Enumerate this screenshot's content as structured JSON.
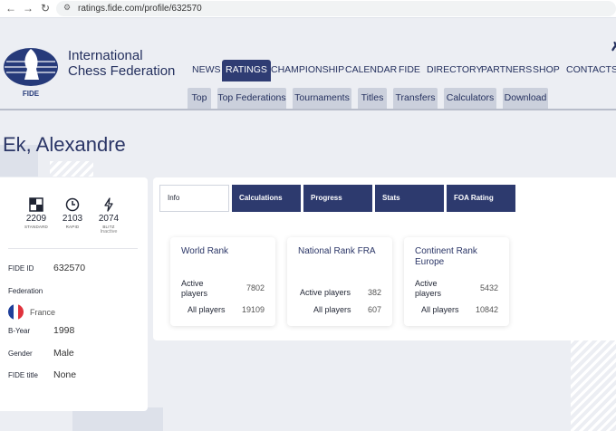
{
  "browser": {
    "back_icon": "arrow-left-icon",
    "forward_icon": "arrow-right-icon",
    "reload_icon": "reload-icon",
    "url": "ratings.fide.com/profile/632570"
  },
  "header": {
    "logo_text": "FIDE",
    "org_line1": "International",
    "org_line2": "Chess Federation",
    "main_nav": [
      "NEWS",
      "RATINGS",
      "CHAMPIONSHIP",
      "CALENDAR",
      "FIDE",
      "DIRECTORY",
      "PARTNERS",
      "SHOP",
      "CONTACTS"
    ],
    "active_nav": "RATINGS",
    "sub_nav": [
      "Top",
      "Top Federations",
      "Tournaments",
      "Titles",
      "Transfers",
      "Calculators",
      "Download"
    ]
  },
  "player": {
    "name": "Ek, Alexandre",
    "ratings": [
      {
        "value": "2209",
        "label": "STANDARD",
        "note": "",
        "icon": "standard-board-icon"
      },
      {
        "value": "2103",
        "label": "RAPID",
        "note": "",
        "icon": "clock-icon"
      },
      {
        "value": "2074",
        "label": "BLITZ",
        "note": "Inactive",
        "icon": "lightning-icon"
      }
    ],
    "fields": {
      "fide_id_label": "FIDE ID",
      "fide_id": "632570",
      "federation_label": "Federation",
      "country": "France",
      "byear_label": "B-Year",
      "byear": "1998",
      "gender_label": "Gender",
      "gender": "Male",
      "title_label": "FIDE title",
      "title": "None"
    }
  },
  "tabs": [
    "Info",
    "Calculations",
    "Progress",
    "Stats",
    "FOA Rating"
  ],
  "active_tab": "Info",
  "ranks": [
    {
      "title": "World Rank",
      "active_label": "Active players",
      "active": "7802",
      "all_label": "All players",
      "all": "19109"
    },
    {
      "title": "National Rank FRA",
      "active_label": "Active players",
      "active": "382",
      "all_label": "All players",
      "all": "607"
    },
    {
      "title": "Continent Rank Europe",
      "active_label": "Active players",
      "active": "5432",
      "all_label": "All players",
      "all": "10842"
    }
  ],
  "colors": {
    "navy": "#2d3a6e",
    "page_bg": "#eceef3",
    "flag_blue": "#1f3f9a",
    "flag_red": "#e0323c"
  }
}
